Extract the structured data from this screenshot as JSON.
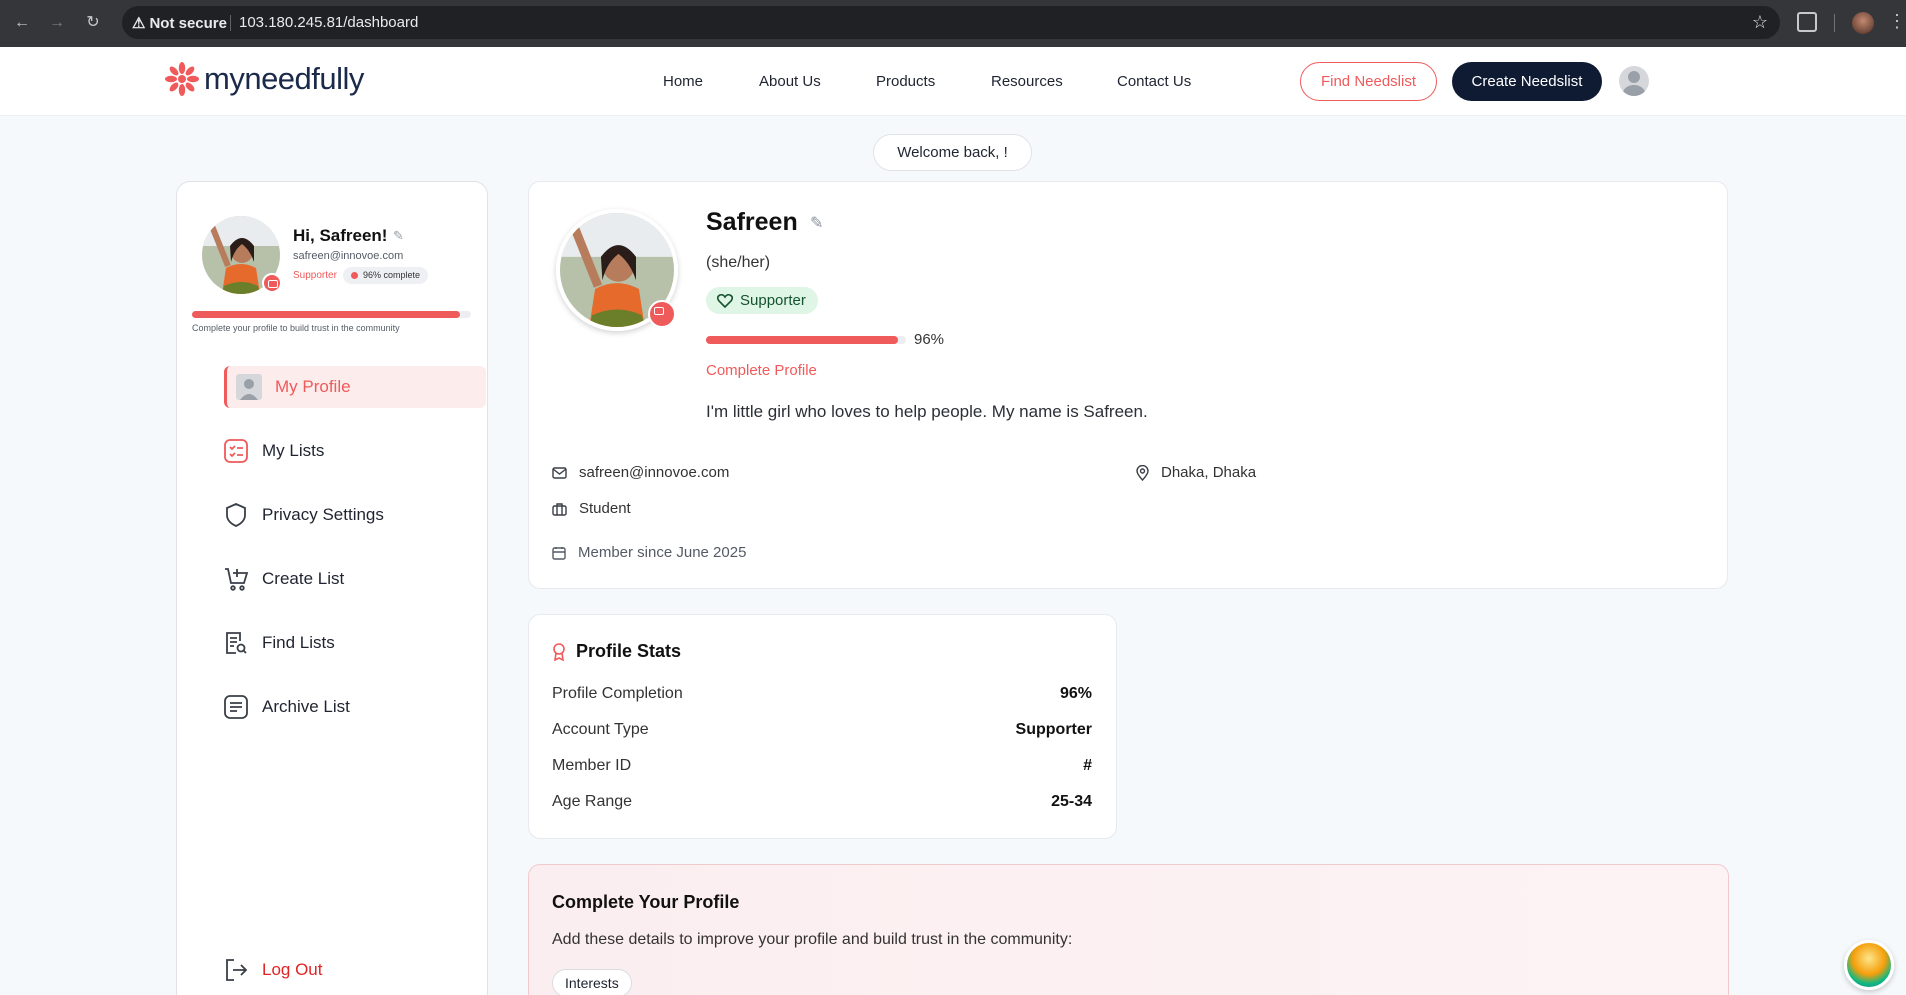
{
  "browser": {
    "security_label": "Not secure",
    "url": "103.180.245.81/dashboard"
  },
  "header": {
    "logo_text": "myneedfully",
    "nav": [
      "Home",
      "About Us",
      "Products",
      "Resources",
      "Contact Us"
    ],
    "find_button": "Find Needslist",
    "create_button": "Create Needslist"
  },
  "welcome": "Welcome back, !",
  "sidebar": {
    "greeting": "Hi, Safreen!",
    "email": "safreen@innovoe.com",
    "role": "Supporter",
    "completion_pill": "96% complete",
    "progress": 0.96,
    "progress_note": "Complete your profile to build trust in the community",
    "items": [
      {
        "label": "My Profile",
        "icon": "user-icon"
      },
      {
        "label": "My Lists",
        "icon": "checklist-icon"
      },
      {
        "label": "Privacy Settings",
        "icon": "shield-icon"
      },
      {
        "label": "Create List",
        "icon": "cart-plus-icon"
      },
      {
        "label": "Find Lists",
        "icon": "list-search-icon"
      },
      {
        "label": "Archive List",
        "icon": "archive-icon"
      }
    ],
    "logout": "Log Out"
  },
  "profile": {
    "name": "Safreen",
    "pronouns": "(she/her)",
    "badge": "Supporter",
    "progress": 0.96,
    "progress_label": "96%",
    "complete_link": "Complete Profile",
    "bio": "I'm little girl who loves to help people. My name is Safreen.",
    "email": "safreen@innovoe.com",
    "location": "Dhaka, Dhaka",
    "occupation": "Student",
    "member_since": "Member since June 2025"
  },
  "stats": {
    "title": "Profile Stats",
    "rows": [
      {
        "label": "Profile Completion",
        "value": "96%"
      },
      {
        "label": "Account Type",
        "value": "Supporter"
      },
      {
        "label": "Member ID",
        "value": "#"
      },
      {
        "label": "Age Range",
        "value": "25-34"
      }
    ]
  },
  "complete": {
    "title": "Complete Your Profile",
    "subtitle": "Add these details to improve your profile and build trust in the community:",
    "chips": [
      "Interests"
    ]
  },
  "colors": {
    "accent": "#ef5a5a",
    "navy": "#0f1b33",
    "success_bg": "#dff5e6"
  }
}
